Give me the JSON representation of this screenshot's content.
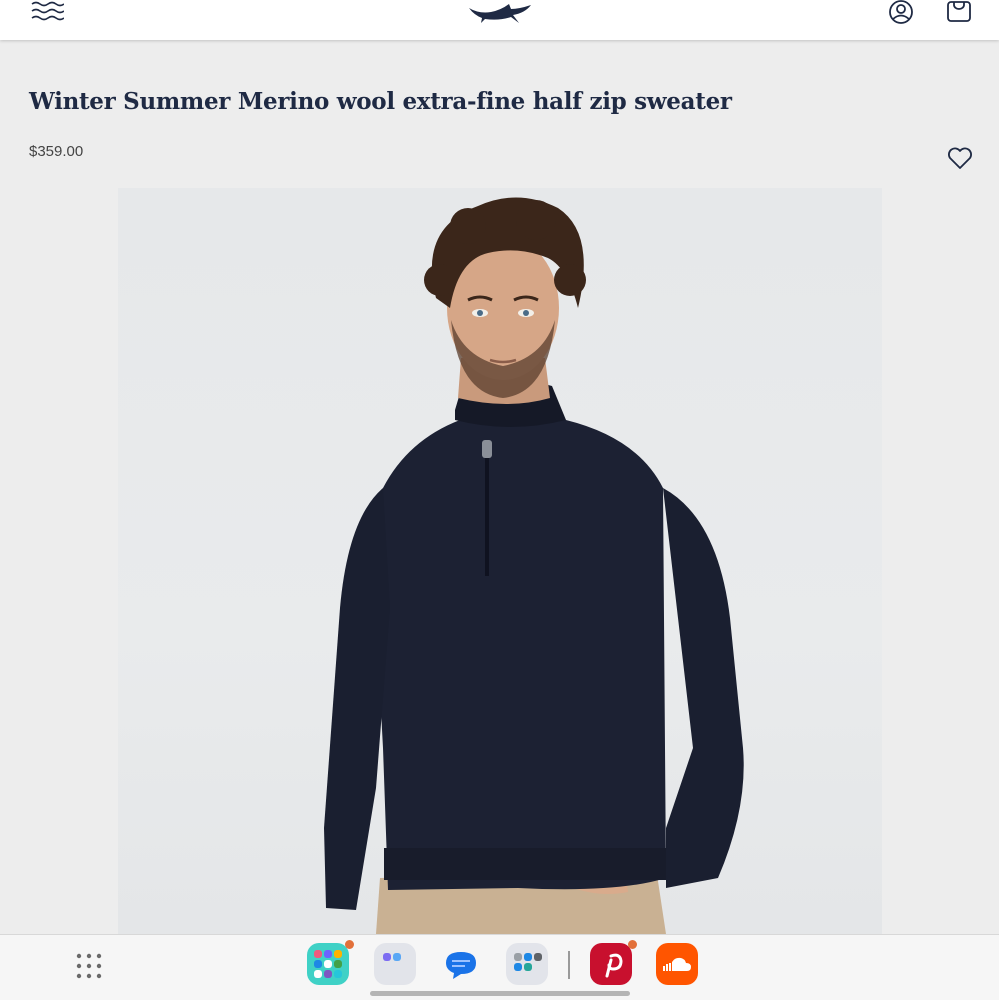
{
  "header": {
    "icons": [
      "menu-waves-icon",
      "shark-logo-icon",
      "account-icon",
      "shopping-bag-icon"
    ]
  },
  "product": {
    "title": "Winter Summer Merino wool extra-fine half zip sweater",
    "price": "$359.00",
    "wishlist_icon": "heart-outline-icon"
  },
  "colors": {
    "title": "#1f2a44",
    "sweater": "#1c2133",
    "page_bg": "#ededed"
  },
  "dock": {
    "apps": [
      "app-drawer-icon",
      "app-folder-icon",
      "folder-icon",
      "messages-icon",
      "folder-icon",
      "pinterest-icon",
      "soundcloud-icon"
    ]
  }
}
